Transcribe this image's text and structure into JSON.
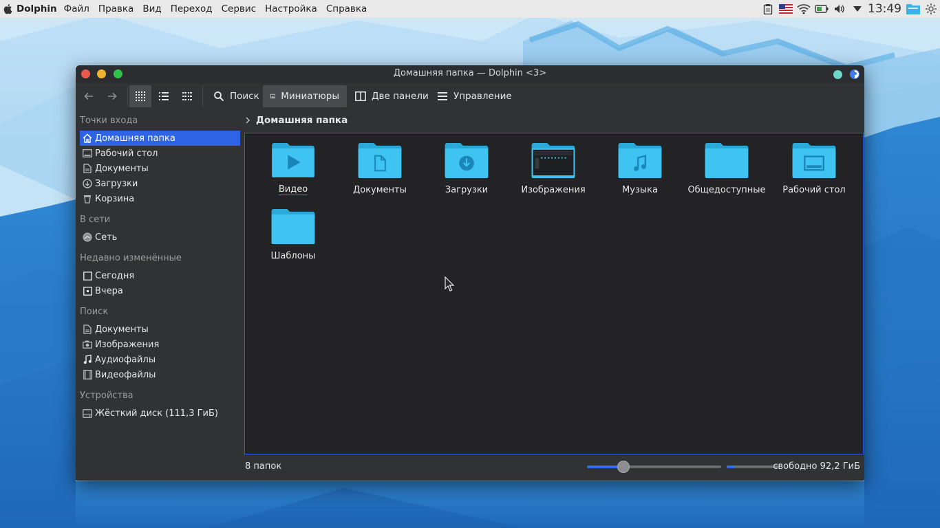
{
  "topbar": {
    "app_name": "Dolphin",
    "menus": [
      "Файл",
      "Правка",
      "Вид",
      "Переход",
      "Сервис",
      "Настройка",
      "Справка"
    ],
    "clock": "13:49",
    "tray_icons": [
      "clipboard-icon",
      "us-flag-icon",
      "wifi-icon",
      "battery-icon",
      "volume-icon",
      "dropdown-arrow-icon"
    ]
  },
  "window": {
    "title": "Домашняя папка — Dolphin <3>",
    "traffic_lights": {
      "close": "#e95b4e",
      "minimize": "#f0b32f",
      "maximize": "#2fc24a"
    }
  },
  "toolbar": {
    "search_label": "Поиск",
    "preview_label": "Миниатюры",
    "split_label": "Две панели",
    "control_label": "Управление"
  },
  "sidebar": {
    "sections": [
      {
        "title": "Точки входа",
        "items": [
          {
            "label": "Домашняя папка",
            "icon": "home-icon",
            "active": true
          },
          {
            "label": "Рабочий стол",
            "icon": "desktop-icon"
          },
          {
            "label": "Документы",
            "icon": "documents-icon"
          },
          {
            "label": "Загрузки",
            "icon": "downloads-icon"
          },
          {
            "label": "Корзина",
            "icon": "trash-icon"
          }
        ]
      },
      {
        "title": "В сети",
        "items": [
          {
            "label": "Сеть",
            "icon": "network-icon"
          }
        ]
      },
      {
        "title": "Недавно изменённые",
        "items": [
          {
            "label": "Сегодня",
            "icon": "calendar-today-icon"
          },
          {
            "label": "Вчера",
            "icon": "calendar-yesterday-icon"
          }
        ]
      },
      {
        "title": "Поиск",
        "items": [
          {
            "label": "Документы",
            "icon": "documents-icon"
          },
          {
            "label": "Изображения",
            "icon": "camera-icon"
          },
          {
            "label": "Аудиофайлы",
            "icon": "music-note-icon"
          },
          {
            "label": "Видеофайлы",
            "icon": "film-icon"
          }
        ]
      },
      {
        "title": "Устройства",
        "items": [
          {
            "label": "Жёсткий диск (111,3 ГиБ)",
            "icon": "hard-drive-icon"
          }
        ]
      }
    ]
  },
  "breadcrumb": {
    "path": "Домашняя папка"
  },
  "files": [
    {
      "name": "Видео",
      "emblem": "video",
      "selected": true
    },
    {
      "name": "Документы",
      "emblem": "document"
    },
    {
      "name": "Загрузки",
      "emblem": "download"
    },
    {
      "name": "Изображения",
      "emblem": "thumbnail"
    },
    {
      "name": "Музыка",
      "emblem": "music"
    },
    {
      "name": "Общедоступные",
      "emblem": "none"
    },
    {
      "name": "Рабочий стол",
      "emblem": "desktop"
    },
    {
      "name": "Шаблоны",
      "emblem": "none"
    }
  ],
  "status": {
    "text": "8 папок",
    "zoom_level": 0.27,
    "used_fraction": 0.14,
    "free_space": "свободно 92,2 ГиБ"
  },
  "colors": {
    "accent": "#2f63e6",
    "folder": "#3fc3f0",
    "folder_dark": "#2aa8d8"
  }
}
